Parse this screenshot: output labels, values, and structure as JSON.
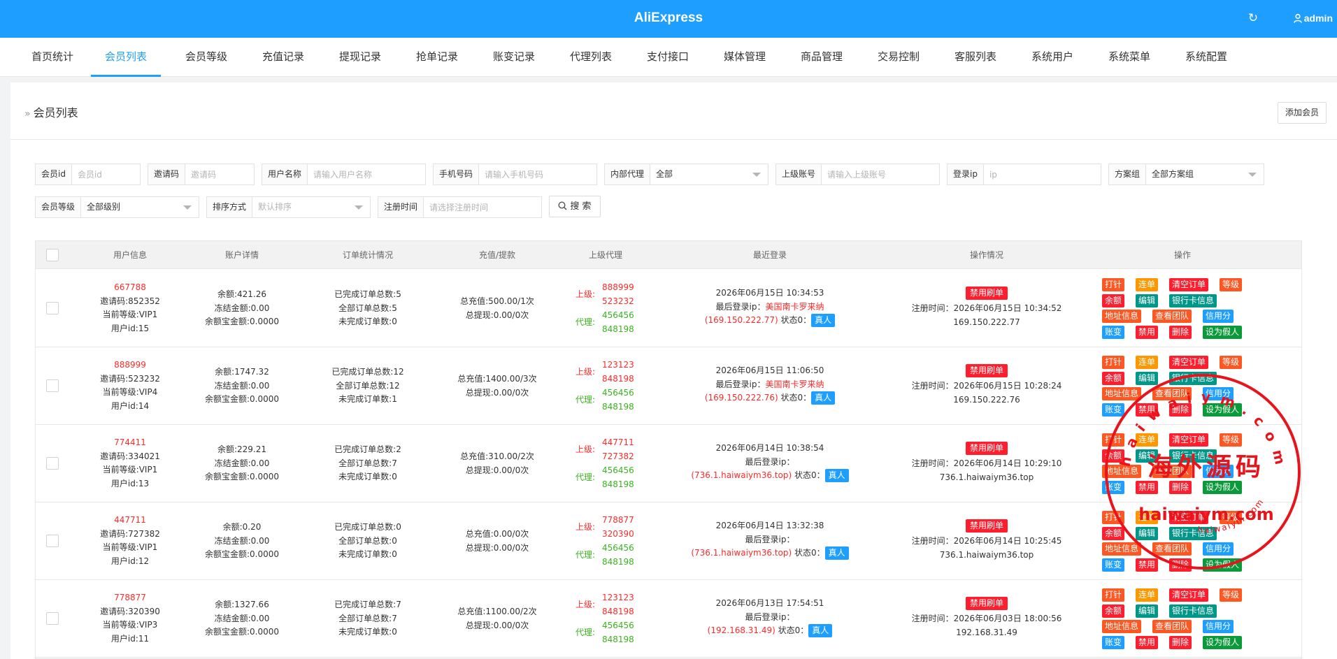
{
  "topbar": {
    "title": "AliExpress",
    "user": "admin"
  },
  "nav": {
    "tabs": [
      {
        "label": "首页统计"
      },
      {
        "label": "会员列表"
      },
      {
        "label": "会员等级"
      },
      {
        "label": "充值记录"
      },
      {
        "label": "提现记录"
      },
      {
        "label": "抢单记录"
      },
      {
        "label": "账变记录"
      },
      {
        "label": "代理列表"
      },
      {
        "label": "支付接口"
      },
      {
        "label": "媒体管理"
      },
      {
        "label": "商品管理"
      },
      {
        "label": "交易控制"
      },
      {
        "label": "客服列表"
      },
      {
        "label": "系统用户"
      },
      {
        "label": "系统菜单"
      },
      {
        "label": "系统配置"
      }
    ]
  },
  "page": {
    "crumb": "会员列表",
    "add_button": "添加会员"
  },
  "filters": {
    "member_id": {
      "label": "会员id",
      "placeholder": "会员id"
    },
    "invite_code": {
      "label": "邀请码",
      "placeholder": "邀请码"
    },
    "username": {
      "label": "用户名称",
      "placeholder": "请输入用户名称"
    },
    "phone": {
      "label": "手机号码",
      "placeholder": "请输入手机号码"
    },
    "internal_agent": {
      "label": "内部代理",
      "value": "全部"
    },
    "parent_account": {
      "label": "上级账号",
      "placeholder": "请输入上级账号"
    },
    "login_ip": {
      "label": "登录ip",
      "placeholder": "ip"
    },
    "plan_group": {
      "label": "方案组",
      "value": "全部方案组"
    },
    "member_level": {
      "label": "会员等级",
      "value": "全部级别"
    },
    "sort": {
      "label": "排序方式",
      "value": "默认排序"
    },
    "reg_time": {
      "label": "注册时间",
      "placeholder": "请选择注册时间"
    },
    "search_button": "搜 索"
  },
  "table": {
    "headers": [
      "用户信息",
      "账户详情",
      "订单统计情况",
      "充值/提款",
      "上级代理",
      "最近登录",
      "操作情况",
      "操作"
    ],
    "ops_labels": {
      "punch": "打针",
      "combo": "连单",
      "clear_orders": "清空订单",
      "level": "等级",
      "balance": "余额",
      "edit": "编辑",
      "bank_card": "银行卡信息",
      "address": "地址信息",
      "view_team": "查看团队",
      "credit": "信用分",
      "ledger": "账变",
      "ban": "禁用",
      "delete": "删除",
      "set_fake": "设为假人"
    },
    "labels": {
      "upline": "上级:",
      "agent": "代理:",
      "last_login_ip": "最后登录ip：",
      "status": "状态0：",
      "real_person": "真人",
      "reg_time": "注册时间：",
      "ban_brush": "禁用刷单"
    },
    "rows": [
      {
        "user_no": "667788",
        "invite": "邀请码:852352",
        "level": "当前等级:VIP1",
        "uid": "用户id:15",
        "balance": "余额:421.26",
        "frozen": "冻结金额:0.00",
        "yuebao": "余额宝金额:0.0000",
        "orders_done": "已完成订单总数:5",
        "orders_all": "全部订单总数:5",
        "orders_pending": "未完成订单数:0",
        "recharge": "总充值:500.00/1次",
        "withdraw": "总提现:0.00/0次",
        "up1": "888999",
        "up2": "523232",
        "agent1": "456456",
        "agent2": "848198",
        "login_time": "2026年06月15日 10:34:53",
        "login_loc": "美国南卡罗来纳",
        "login_ip": "(169.150.222.77)",
        "reg_time": "2026年06月15日 10:34:52",
        "reg_ip": "169.150.222.77"
      },
      {
        "user_no": "888999",
        "invite": "邀请码:523232",
        "level": "当前等级:VIP4",
        "uid": "用户id:14",
        "balance": "余额:1747.32",
        "frozen": "冻结金额:0.00",
        "yuebao": "余额宝金额:0.0000",
        "orders_done": "已完成订单总数:12",
        "orders_all": "全部订单总数:12",
        "orders_pending": "未完成订单数:1",
        "recharge": "总充值:1400.00/3次",
        "withdraw": "总提现:0.00/0次",
        "up1": "123123",
        "up2": "848198",
        "agent1": "456456",
        "agent2": "848198",
        "login_time": "2026年06月15日 11:06:50",
        "login_loc": "美国南卡罗来纳",
        "login_ip": "(169.150.222.76)",
        "reg_time": "2026年06月15日 10:28:24",
        "reg_ip": "169.150.222.76"
      },
      {
        "user_no": "774411",
        "invite": "邀请码:334021",
        "level": "当前等级:VIP1",
        "uid": "用户id:13",
        "balance": "余额:229.21",
        "frozen": "冻结金额:0.00",
        "yuebao": "余额宝金额:0.0000",
        "orders_done": "已完成订单总数:2",
        "orders_all": "全部订单总数:7",
        "orders_pending": "未完成订单数:0",
        "recharge": "总充值:310.00/2次",
        "withdraw": "总提现:0.00/0次",
        "up1": "447711",
        "up2": "727382",
        "agent1": "456456",
        "agent2": "848198",
        "login_time": "2026年06月14日 10:38:54",
        "login_loc": "",
        "login_ip": "(736.1.haiwaiym36.top)",
        "reg_time": "2026年06月14日 10:29:10",
        "reg_ip": "736.1.haiwaiym36.top"
      },
      {
        "user_no": "447711",
        "invite": "邀请码:727382",
        "level": "当前等级:VIP1",
        "uid": "用户id:12",
        "balance": "余额:0.20",
        "frozen": "冻结金额:0.00",
        "yuebao": "余额宝金额:0.0000",
        "orders_done": "已完成订单总数:0",
        "orders_all": "全部订单总数:0",
        "orders_pending": "未完成订单数:0",
        "recharge": "总充值:0.00/0次",
        "withdraw": "总提现:0.00/0次",
        "up1": "778877",
        "up2": "320390",
        "agent1": "456456",
        "agent2": "848198",
        "login_time": "2026年06月14日 13:32:38",
        "login_loc": "",
        "login_ip": "(736.1.haiwaiym36.top)",
        "reg_time": "2026年06月14日 10:25:45",
        "reg_ip": "736.1.haiwaiym36.top"
      },
      {
        "user_no": "778877",
        "invite": "邀请码:320390",
        "level": "当前等级:VIP3",
        "uid": "用户id:11",
        "balance": "余额:1327.66",
        "frozen": "冻结金额:0.00",
        "yuebao": "余额宝金额:0.0000",
        "orders_done": "已完成订单总数:7",
        "orders_all": "全部订单总数:7",
        "orders_pending": "未完成订单数:0",
        "recharge": "总充值:1100.00/2次",
        "withdraw": "总提现:0.00/0次",
        "up1": "123123",
        "up2": "848198",
        "agent1": "456456",
        "agent2": "848198",
        "login_time": "2026年06月13日 17:54:51",
        "login_loc": "",
        "login_ip": "(192.168.31.49)",
        "reg_time": "2026年06月03日 18:00:56",
        "reg_ip": "192.168.31.49"
      }
    ]
  },
  "watermark": {
    "top_arc": "h a i w a i y m . c o m",
    "center": "海外源码",
    "bottom": "haiwaiym.com",
    "small": "haiwaiym.com",
    "color": "#e8131b"
  },
  "colors": {
    "primary": "#1e9fff",
    "danger": "#ff1e2d",
    "success": "#3bb21f"
  }
}
